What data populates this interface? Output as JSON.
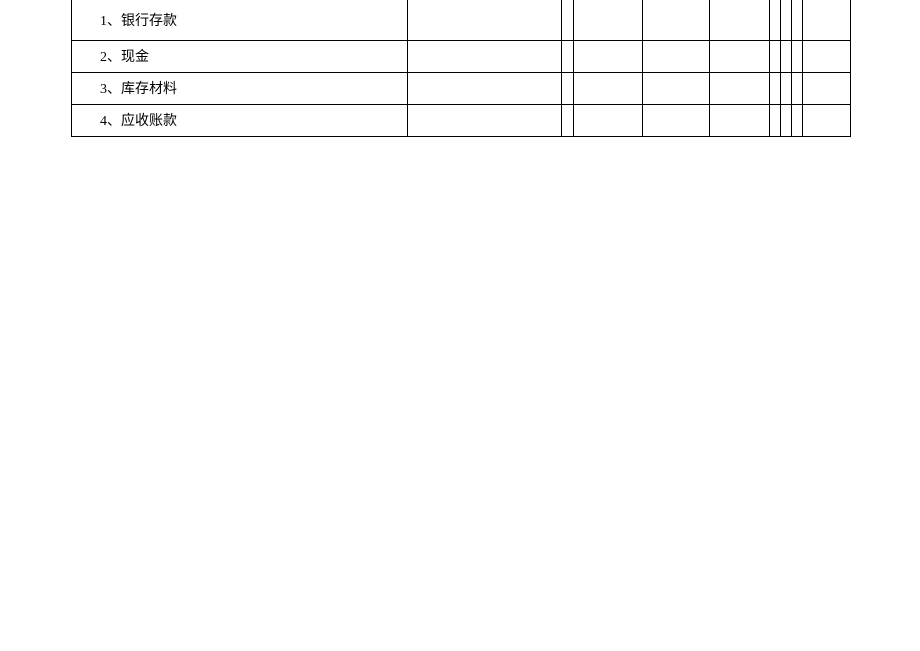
{
  "table": {
    "rows": [
      {
        "label": "1、银行存款"
      },
      {
        "label": "2、现金"
      },
      {
        "label": "3、库存材料"
      },
      {
        "label": "4、应收账款"
      }
    ]
  }
}
